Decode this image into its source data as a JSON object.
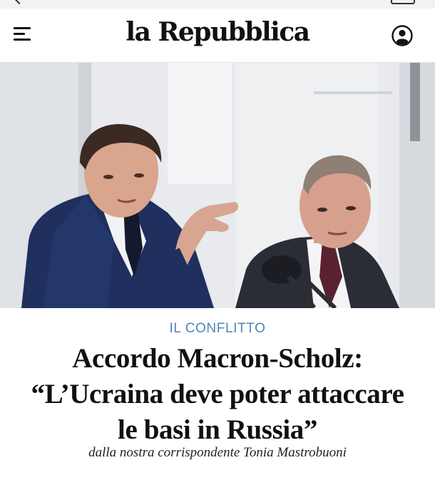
{
  "header": {
    "logo_text": "la Repubblica",
    "menu_icon": "hamburger-menu-icon",
    "account_icon": "user-account-icon"
  },
  "hero": {
    "image_description_icon": "news-photo"
  },
  "article": {
    "kicker": "IL CONFLITTO",
    "headline_lines": [
      "Accordo Macron-Scholz:",
      "“L’Ucraina deve poter attaccare",
      "le basi in Russia”"
    ],
    "byline": "dalla nostra corrispondente Tonia Mastrobuoni"
  },
  "colors": {
    "kicker": "#4f86b8",
    "text": "#111111",
    "background": "#ffffff"
  }
}
